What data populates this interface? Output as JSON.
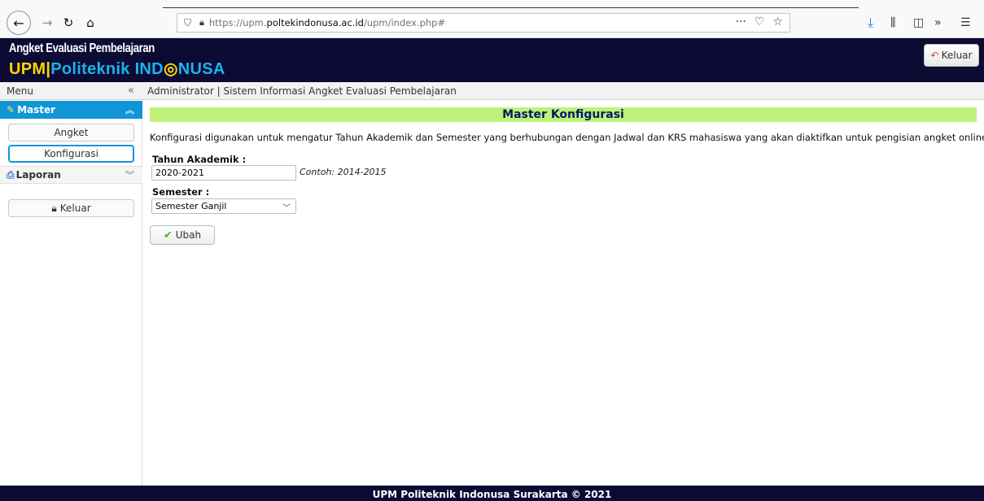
{
  "browser": {
    "url_prefix": "https://upm.",
    "url_domain": "poltekindonusa.ac.id",
    "url_path": "/upm/index.php#",
    "icons": [
      "back-icon",
      "forward-icon",
      "reload-icon",
      "home-icon",
      "shield-icon",
      "lock-icon",
      "more-icon",
      "pocket-icon",
      "star-icon",
      "download-icon",
      "library-icon",
      "sidebar-icon",
      "overflow-icon",
      "hamburger-icon"
    ]
  },
  "header": {
    "line1": "Angket Evaluasi Pembelajaran",
    "upm": "UPM",
    "bar": "|",
    "line2_a": "Politeknik IND",
    "line2_o": "◎",
    "line2_b": "NUSA",
    "logout_label": "Keluar"
  },
  "sidebar": {
    "menu_label": "Menu",
    "master_label": "Master",
    "items": [
      {
        "label": "Angket"
      },
      {
        "label": "Konfigurasi"
      }
    ],
    "laporan_label": "Laporan",
    "logout_label": "Keluar"
  },
  "main": {
    "breadcrumb": "Administrator | Sistem Informasi Angket Evaluasi Pembelajaran",
    "title": "Master Konfigurasi",
    "description": "Konfigurasi digunakan untuk mengatur Tahun Akademik dan Semester yang berhubungan dengan Jadwal dan KRS mahasiswa yang akan diaktifkan untuk pengisian angket online",
    "tahun_label": "Tahun Akademik :",
    "tahun_value": "2020-2021",
    "tahun_hint": "Contoh: 2014-2015",
    "semester_label": "Semester :",
    "semester_value": "Semester Ganjil",
    "submit_label": "Ubah"
  },
  "footer": {
    "text": "UPM Politeknik Indonusa Surakarta © 2021"
  },
  "colors": {
    "header_bg": "#0b0b33",
    "accent_blue": "#1096d6",
    "title_bg": "#bff27a",
    "brand_yellow": "#ffd500",
    "brand_cyan": "#1ab3ef"
  }
}
